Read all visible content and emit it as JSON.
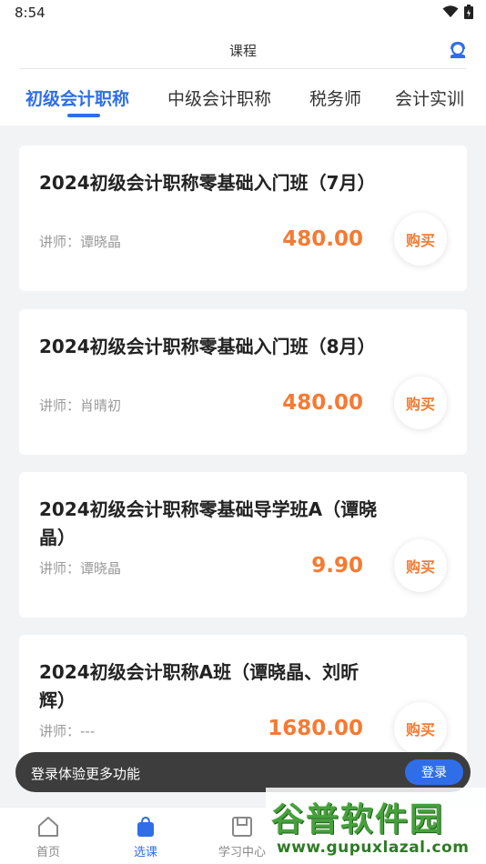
{
  "status": {
    "time": "8:54"
  },
  "header": {
    "title": "课程"
  },
  "tabs": [
    {
      "label": "初级会计职称",
      "active": true
    },
    {
      "label": "中级会计职称",
      "active": false
    },
    {
      "label": "税务师",
      "active": false
    },
    {
      "label": "会计实训",
      "active": false
    }
  ],
  "courses": [
    {
      "title": "2024初级会计职称零基础入门班（7月）",
      "teacher": "讲师：谭晓晶",
      "price": "480.00",
      "buy": "购买"
    },
    {
      "title": "2024初级会计职称零基础入门班（8月）",
      "teacher": "讲师：肖晴初",
      "price": "480.00",
      "buy": "购买"
    },
    {
      "title": "2024初级会计职称零基础导学班A（谭晓晶）",
      "teacher": "讲师：谭晓晶",
      "price": "9.90",
      "buy": "购买"
    },
    {
      "title": "2024初级会计职称A班（谭晓晶、刘昕辉）",
      "teacher": "讲师：---",
      "price": "1680.00",
      "buy": "购买"
    }
  ],
  "login_bar": {
    "text": "登录体验更多功能",
    "button": "登录"
  },
  "bottom_nav": [
    {
      "label": "首页",
      "icon": "home-icon",
      "active": false
    },
    {
      "label": "选课",
      "icon": "bag-icon",
      "active": true
    },
    {
      "label": "学习中心",
      "icon": "save-icon",
      "active": false
    }
  ],
  "watermark": {
    "title": "谷普软件园",
    "url": "www.gupuxlazal.com"
  },
  "colors": {
    "accent": "#2f6ee8",
    "price": "#f57a32",
    "background": "#f2f3f5"
  }
}
